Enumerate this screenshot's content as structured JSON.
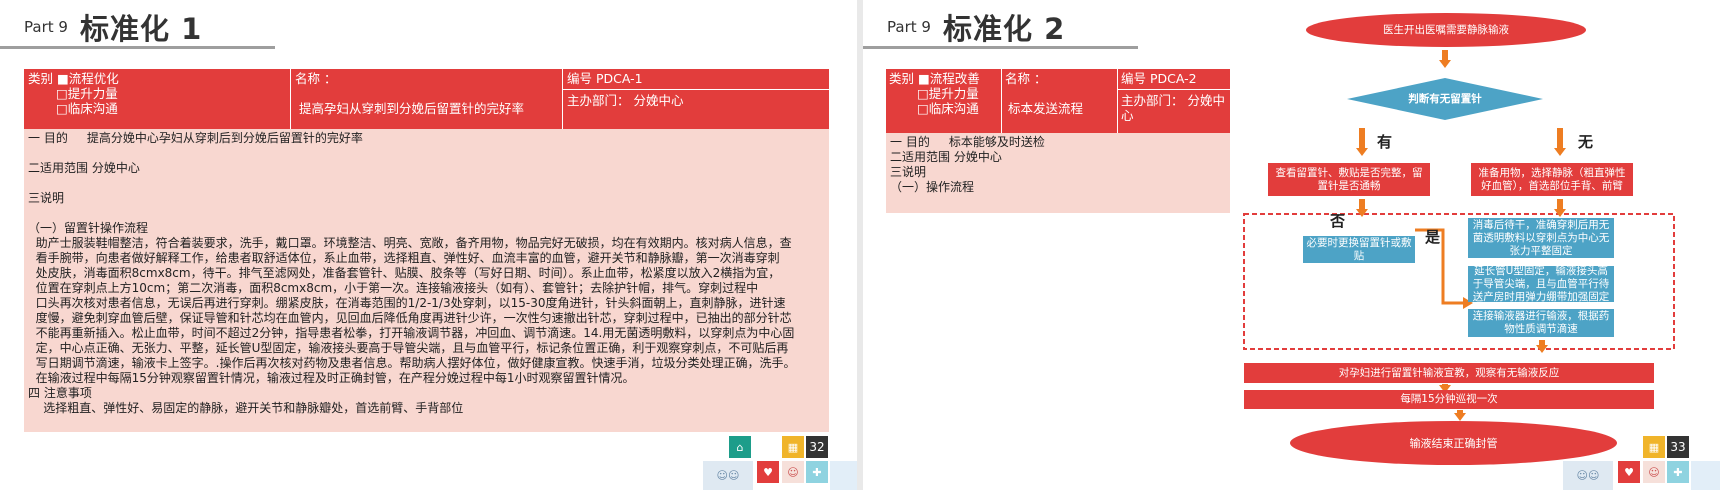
{
  "slide1": {
    "part": "Part 9",
    "title": "标准化 1",
    "header": {
      "category_lines": [
        "类别 ■流程优化",
        "□提升力量",
        "□临床沟通"
      ],
      "name_label": "名称 ：",
      "name_value": "提高孕妇从穿刺到分娩后留置针的完好率",
      "code": "编号 PDCA-1",
      "dept": "主办部门： 分娩中心"
    },
    "body": [
      "一 目的     提高分娩中心孕妇从穿刺后到分娩后留置针的完好率",
      "",
      "二适用范围 分娩中心",
      "",
      "三说明",
      "",
      "（一）留置针操作流程",
      "  助产士服装鞋帽整洁，符合着装要求，洗手，戴口罩。环境整洁、明亮、宽敞，备齐用物，物品完好无破损，均在有效期内。核对病人信息，查",
      "  看手腕带，向患者做好解释工作，给患者取舒适体位，系止血带，选择粗直、弹性好、血流丰富的血管，避开关节和静脉瓣，第一次消毒穿刺",
      "  处皮肤，消毒面积8cmx8cm，待干。排气至滤网处，准备套管针、贴膜、胶条等（写好日期、时间）。系止血带，松紧度以放入2横指为宜，",
      "  位置在穿刺点上方10cm；第二次消毒，面积8cmx8cm，小于第一次。连接输液接头（如有）、套管针；去除护针帽，排气。穿刺过程中",
      "  口头再次核对患者信息，无误后再进行穿刺。绷紧皮肤，在消毒范围的1/2-1/3处穿刺，以15-30度角进针，针头斜面朝上，直刺静脉，进针速",
      "  度慢，避免刺穿血管后壁，保证导管和针芯均在血管内，见回血后降低角度再进针少许，一次性匀速撤出针芯，穿刺过程中，已抽出的部分针芯",
      "  不能再重新插入。松止血带，时间不超过2分钟，指导患者松拳，打开输液调节器，冲回血、调节滴速。14.用无菌透明敷料，以穿刺点为中心固",
      "  定，中心点正确、无张力、平整，延长管U型固定，输液接头要高于导管尖端，且与血管平行，标记条位置正确，利于观察穿刺点，不可贴后再",
      "  写日期调节滴速，输液卡上签字。.操作后再次核对药物及患者信息。帮助病人摆好体位，做好健康宣教。快速手消，垃圾分类处理正确，洗手。",
      "  在输液过程中每隔15分钟观察留置针情况，输液过程及时正确封管，在产程分娩过程中每1小时观察留置针情况。",
      "四 注意事项",
      "    选择粗直、弹性好、易固定的静脉，避开关节和静脉瓣处，首选前臂、手背部位"
    ],
    "page_number": "32"
  },
  "slide2": {
    "part": "Part 9",
    "title": "标准化 2",
    "header": {
      "category_lines": [
        "类别 ■流程改善",
        "□提升力量",
        "□临床沟通"
      ],
      "name_label": "名称 ：",
      "name_value": "标本发送流程",
      "code": "编号 PDCA-2",
      "dept": "主办部门： 分娩中心"
    },
    "body": [
      "一 目的     标本能够及时送检",
      "二适用范围 分娩中心",
      "三说明",
      "（一）操作流程"
    ],
    "flowchart": {
      "start": "医生开出医嘱需要静脉输液",
      "decision": "判断有无留置针",
      "yes_label": "有",
      "no_label": "无",
      "check_box": "查看留置针、敷贴是否完整，留置针是否通畅",
      "prepare_box": "准备用物，选择静脉（粗直弹性好血管），首选部位手背、前臂",
      "no_mark": "否",
      "yes_mark": "是",
      "replace_box": "必要时更换留置针或敷贴",
      "disinfect_box": "消毒后待干，准确穿刺后用无菌透明敷料以穿刺点为中心无张力平整固定",
      "extension_box": "延长管U型固定，输液接头高于导管尖端，且与血管平行待送产房时用弹力绷带加强固定",
      "connect_box": "连接输液器进行输液，根据药物性质调节滴速",
      "educate_bar": "对孕妇进行留置针输液宣教，观察有无输液反应",
      "patrol_bar": "每隔15分钟巡视一次",
      "end": "输液结束正确封管"
    },
    "page_number": "33"
  }
}
